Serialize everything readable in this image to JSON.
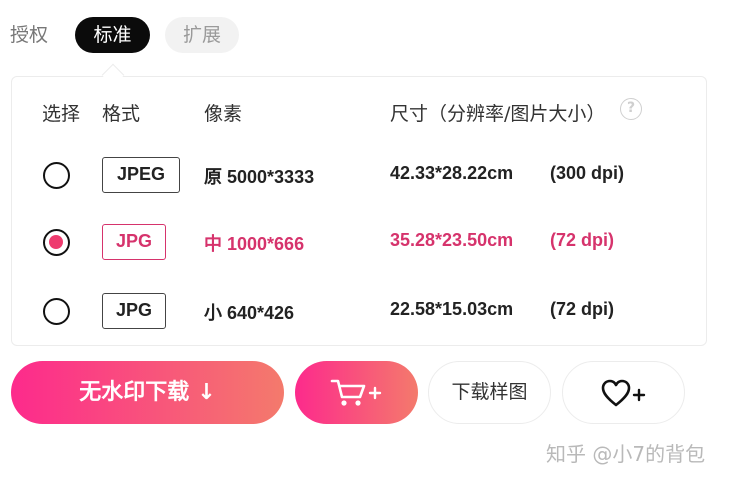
{
  "tabs": {
    "license": "授权",
    "standard": "标准",
    "extended": "扩展"
  },
  "table": {
    "headers": {
      "select": "选择",
      "format": "格式",
      "pixels": "像素",
      "size": "尺寸（分辨率/图片大小）"
    },
    "help_glyph": "?",
    "rows": [
      {
        "format": "JPEG",
        "pixels": "原 5000*3333",
        "size": "42.33*28.22cm",
        "dpi": "(300 dpi)",
        "selected": false
      },
      {
        "format": "JPG",
        "pixels": "中 1000*666",
        "size": "35.28*23.50cm",
        "dpi": "(72 dpi)",
        "selected": true
      },
      {
        "format": "JPG",
        "pixels": "小 640*426",
        "size": "22.58*15.03cm",
        "dpi": "(72 dpi)",
        "selected": false
      }
    ]
  },
  "actions": {
    "download_label": "无水印下载",
    "download_arrow": "↓",
    "sample_label": "下载样图",
    "cart_icon": "cart-plus-icon",
    "fav_icon": "heart-plus-icon"
  },
  "watermark": "知乎 @小7的背包",
  "colors": {
    "accent": "#d6336c",
    "gradient_start": "#fd2a8c",
    "gradient_end": "#f47a6c",
    "radio_dot": "#ee3b6e"
  }
}
